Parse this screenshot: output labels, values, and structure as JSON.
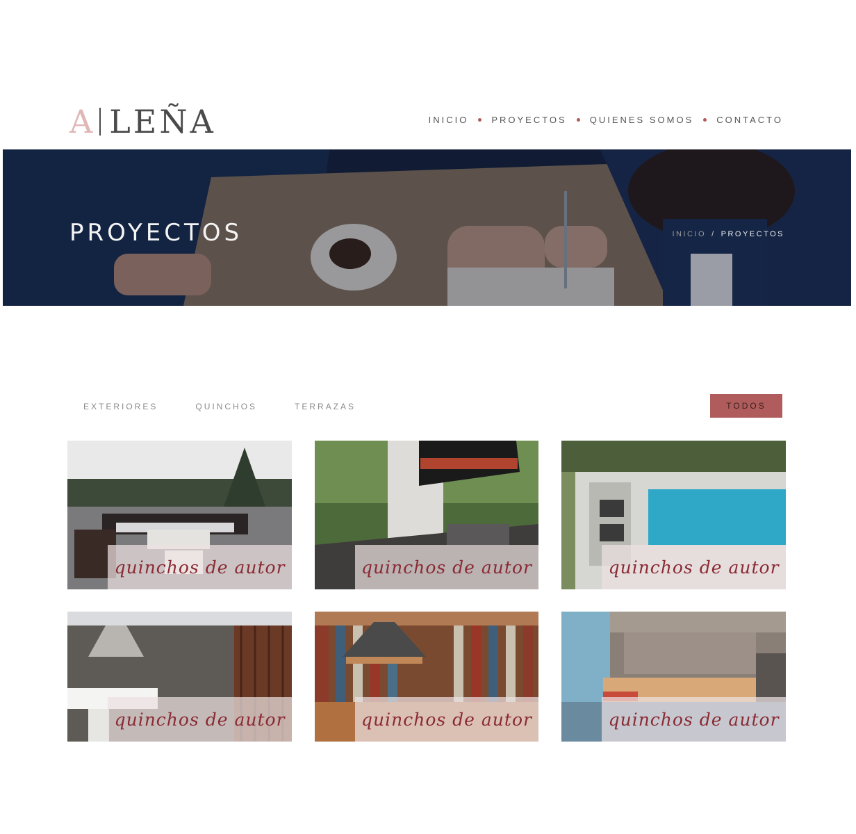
{
  "brand": {
    "logo_a": "A",
    "logo_rest": "LEÑA"
  },
  "nav": {
    "items": [
      "INICIO",
      "PROYECTOS",
      "QUIENES SOMOS",
      "CONTACTO"
    ]
  },
  "hero": {
    "title": "PROYECTOS",
    "breadcrumb_home": "INICIO",
    "breadcrumb_sep": "/",
    "breadcrumb_current": "PROYECTOS"
  },
  "filters": {
    "items": [
      "EXTERIORES",
      "QUINCHOS",
      "TERRAZAS"
    ],
    "active": "TODOS"
  },
  "projects": [
    {
      "label": "quinchos de autor"
    },
    {
      "label": "quinchos de autor"
    },
    {
      "label": "quinchos de autor"
    },
    {
      "label": "quinchos de autor"
    },
    {
      "label": "quinchos de autor"
    },
    {
      "label": "quinchos de autor"
    }
  ],
  "colors": {
    "accent": "#b05c5c",
    "label_text": "#8a2a34",
    "logo_light": "#e0b7b7"
  }
}
